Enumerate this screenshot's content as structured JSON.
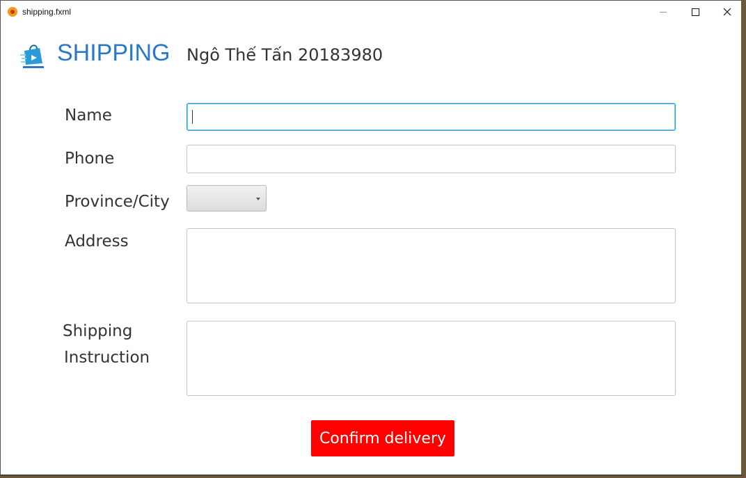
{
  "window": {
    "title": "shipping.fxml",
    "controls": [
      "minimize",
      "maximize",
      "close"
    ]
  },
  "header": {
    "brand": "SHIPPING",
    "student": "Ngô Thế Tấn 20183980",
    "logo_icon": "shopping-bag-icon"
  },
  "form": {
    "name_label": "Name",
    "name_value": "",
    "phone_label": "Phone",
    "phone_value": "",
    "province_label": "Province/City",
    "province_selected": "",
    "address_label": "Address",
    "address_value": "",
    "instruction_label_line1": "Shipping",
    "instruction_label_line2": "Instruction",
    "instruction_value": ""
  },
  "actions": {
    "confirm_label": "Confirm delivery"
  },
  "colors": {
    "brand": "#2a78c9",
    "confirm_bg": "#ff0000",
    "focus_border": "#1c9fd8"
  }
}
